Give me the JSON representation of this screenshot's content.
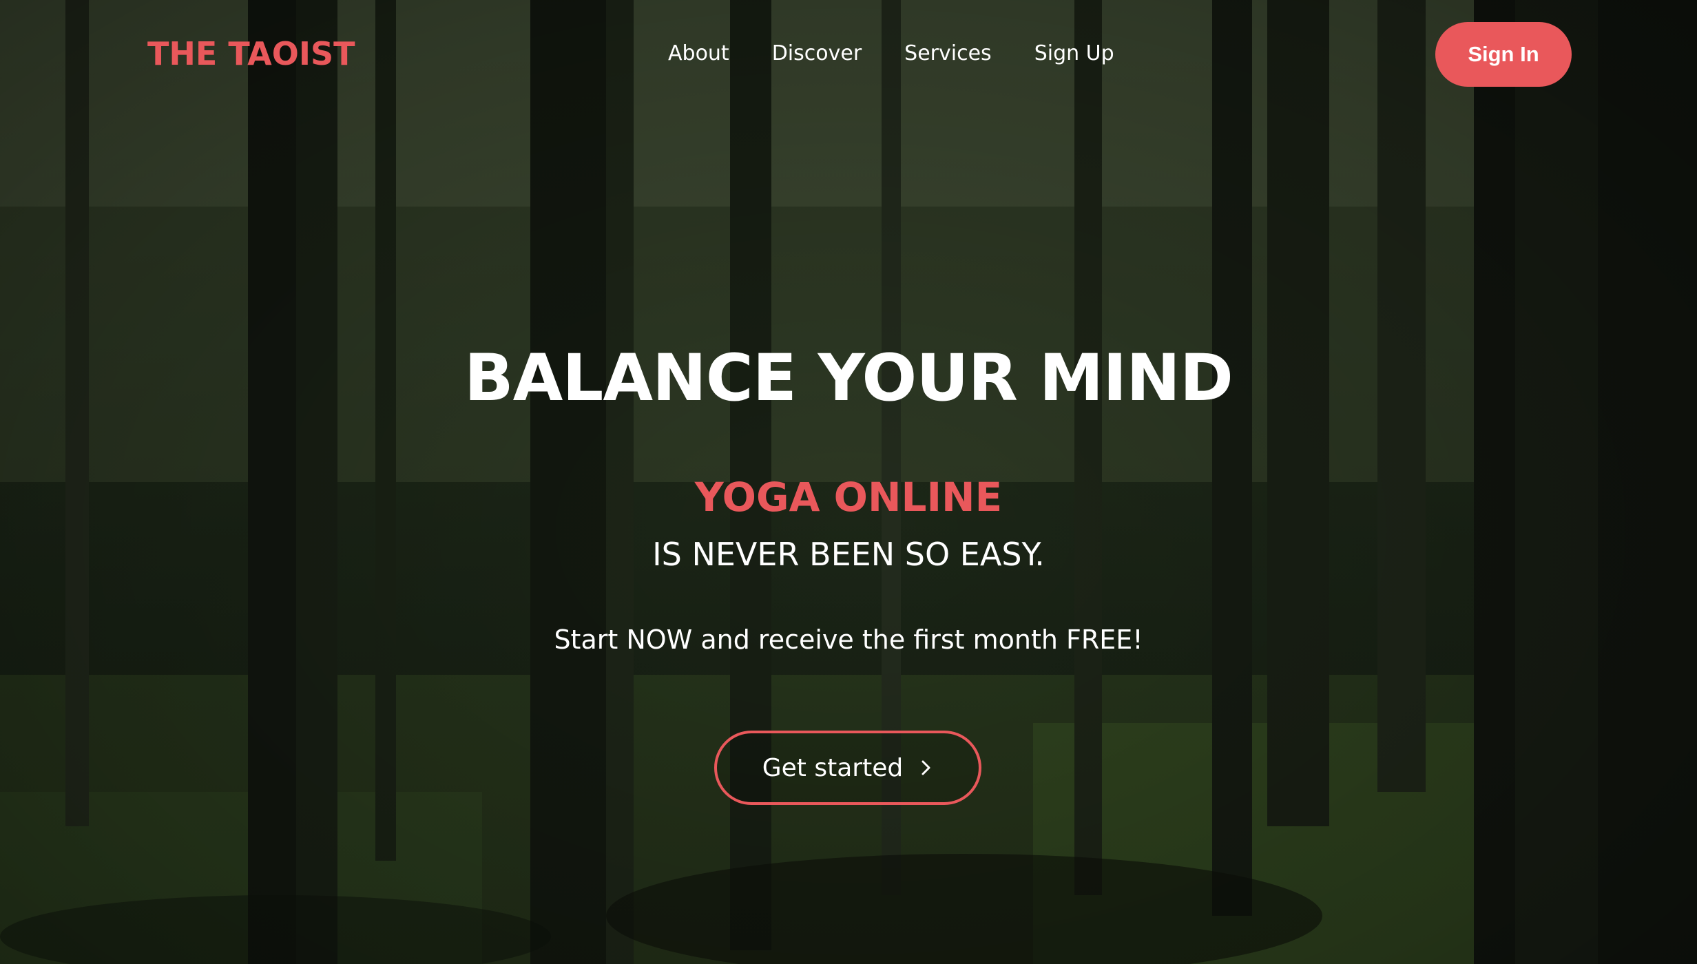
{
  "header": {
    "logo": "THE TAOIST",
    "nav": [
      {
        "label": "About"
      },
      {
        "label": "Discover"
      },
      {
        "label": "Services"
      },
      {
        "label": "Sign Up"
      }
    ],
    "signin_label": "Sign In"
  },
  "hero": {
    "headline": "BALANCE YOUR MIND",
    "accent": "YOGA ONLINE",
    "subline": "IS NEVER BEEN SO EASY.",
    "promo": "Start NOW and receive the first month FREE!",
    "cta_label": "Get started",
    "cta_icon": "chevron-right-icon"
  },
  "colors": {
    "accent": "#e9585b",
    "text": "#ffffff",
    "background": "#26331f"
  }
}
